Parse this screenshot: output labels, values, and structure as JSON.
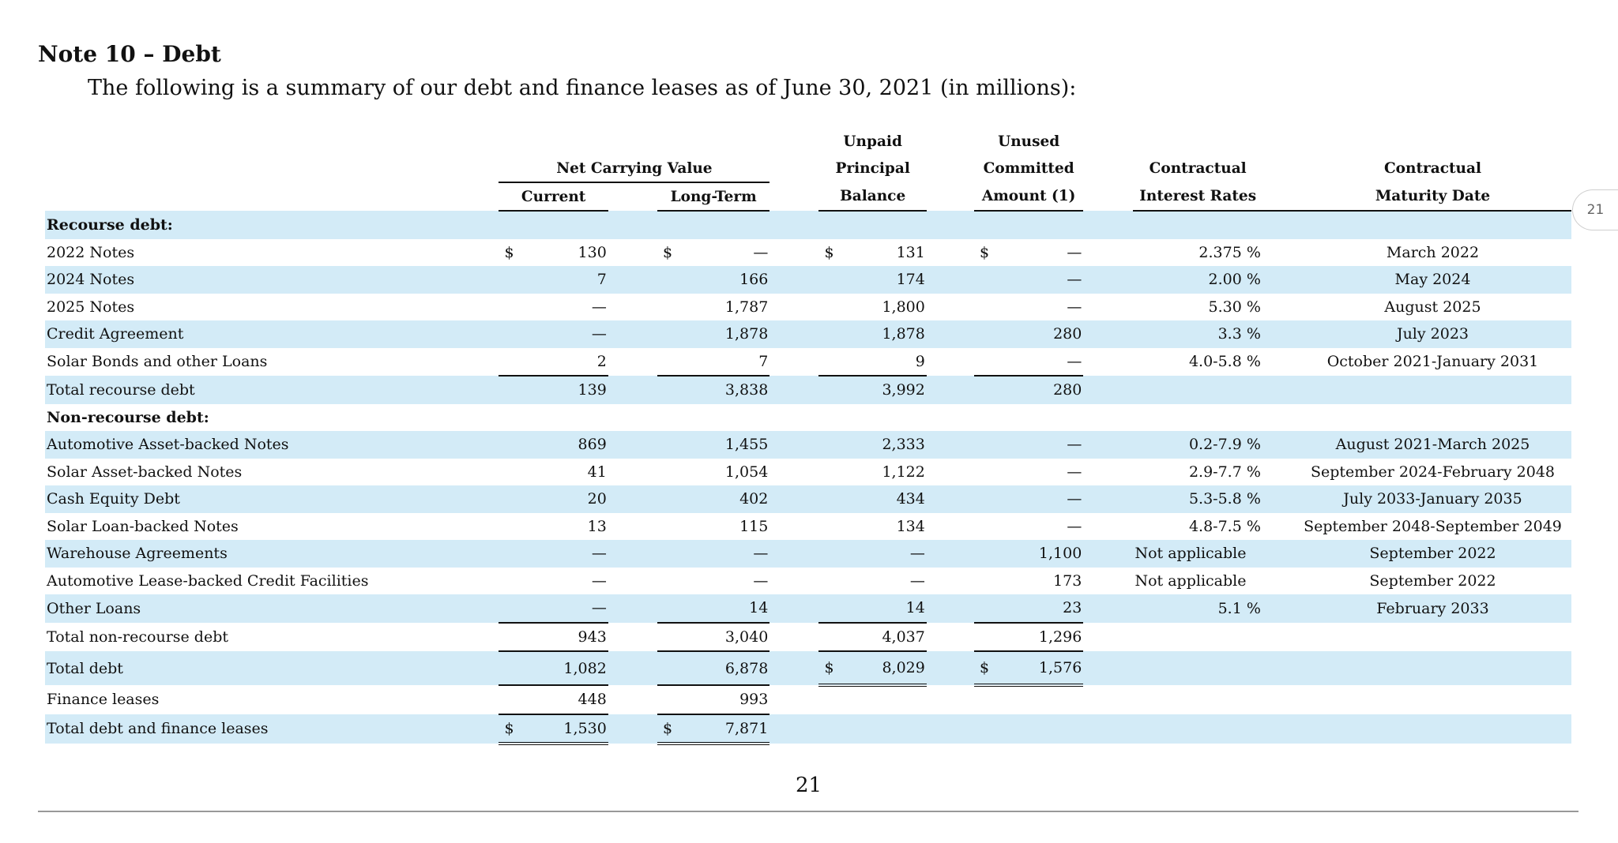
{
  "note_title": "Note 10 – Debt",
  "intro": "The following is a summary of our debt and finance leases as of June 30, 2021 (in millions):",
  "headers": {
    "group_net_carrying": "Net Carrying Value",
    "current": "Current",
    "long_term": "Long-Term",
    "unpaid": [
      "Unpaid",
      "Principal",
      "Balance"
    ],
    "unused": [
      "Unused",
      "Committed",
      "Amount (1)"
    ],
    "interest": [
      "Contractual",
      "Interest Rates"
    ],
    "maturity": [
      "Contractual",
      "Maturity Date"
    ]
  },
  "currency_symbol": "$",
  "sections": {
    "recourse": "Recourse debt:",
    "non_recourse": "Non-recourse debt:"
  },
  "rows": [
    {
      "label": "2022 Notes",
      "current": "130",
      "long_term": "—",
      "unpaid": "131",
      "unused": "—",
      "rate": "2.375 %",
      "maturity": "March 2022"
    },
    {
      "label": "2024 Notes",
      "current": "7",
      "long_term": "166",
      "unpaid": "174",
      "unused": "—",
      "rate": "2.00 %",
      "maturity": "May 2024"
    },
    {
      "label": "2025 Notes",
      "current": "—",
      "long_term": "1,787",
      "unpaid": "1,800",
      "unused": "—",
      "rate": "5.30 %",
      "maturity": "August 2025"
    },
    {
      "label": "Credit Agreement",
      "current": "—",
      "long_term": "1,878",
      "unpaid": "1,878",
      "unused": "280",
      "rate": "3.3 %",
      "maturity": "July 2023"
    },
    {
      "label": "Solar Bonds and other Loans",
      "current": "2",
      "long_term": "7",
      "unpaid": "9",
      "unused": "—",
      "rate": "4.0-5.8 %",
      "maturity": "October 2021-January 2031"
    },
    {
      "label": "Total recourse debt",
      "current": "139",
      "long_term": "3,838",
      "unpaid": "3,992",
      "unused": "280",
      "rate": "",
      "maturity": ""
    },
    {
      "label": "Automotive Asset-backed Notes",
      "current": "869",
      "long_term": "1,455",
      "unpaid": "2,333",
      "unused": "—",
      "rate": "0.2-7.9 %",
      "maturity": "August 2021-March 2025"
    },
    {
      "label": "Solar Asset-backed Notes",
      "current": "41",
      "long_term": "1,054",
      "unpaid": "1,122",
      "unused": "—",
      "rate": "2.9-7.7 %",
      "maturity": "September 2024-February 2048"
    },
    {
      "label": "Cash Equity Debt",
      "current": "20",
      "long_term": "402",
      "unpaid": "434",
      "unused": "—",
      "rate": "5.3-5.8 %",
      "maturity": "July 2033-January 2035"
    },
    {
      "label": "Solar Loan-backed Notes",
      "current": "13",
      "long_term": "115",
      "unpaid": "134",
      "unused": "—",
      "rate": "4.8-7.5 %",
      "maturity": "September 2048-September 2049"
    },
    {
      "label": "Warehouse Agreements",
      "current": "—",
      "long_term": "—",
      "unpaid": "—",
      "unused": "1,100",
      "rate": "Not applicable",
      "maturity": "September 2022"
    },
    {
      "label": "Automotive Lease-backed Credit Facilities",
      "current": "—",
      "long_term": "—",
      "unpaid": "—",
      "unused": "173",
      "rate": "Not applicable",
      "maturity": "September 2022"
    },
    {
      "label": "Other Loans",
      "current": "—",
      "long_term": "14",
      "unpaid": "14",
      "unused": "23",
      "rate": "5.1 %",
      "maturity": "February 2033"
    },
    {
      "label": "Total non-recourse debt",
      "current": "943",
      "long_term": "3,040",
      "unpaid": "4,037",
      "unused": "1,296",
      "rate": "",
      "maturity": ""
    },
    {
      "label": "Total debt",
      "current": "1,082",
      "long_term": "6,878",
      "unpaid": "8,029",
      "unused": "1,576",
      "rate": "",
      "maturity": ""
    },
    {
      "label": "Finance leases",
      "current": "448",
      "long_term": "993",
      "unpaid": "",
      "unused": "",
      "rate": "",
      "maturity": ""
    },
    {
      "label": "Total debt and finance leases",
      "current": "1,530",
      "long_term": "7,871",
      "unpaid": "",
      "unused": "",
      "rate": "",
      "maturity": ""
    }
  ],
  "page_number": "21",
  "page_tab": "21"
}
